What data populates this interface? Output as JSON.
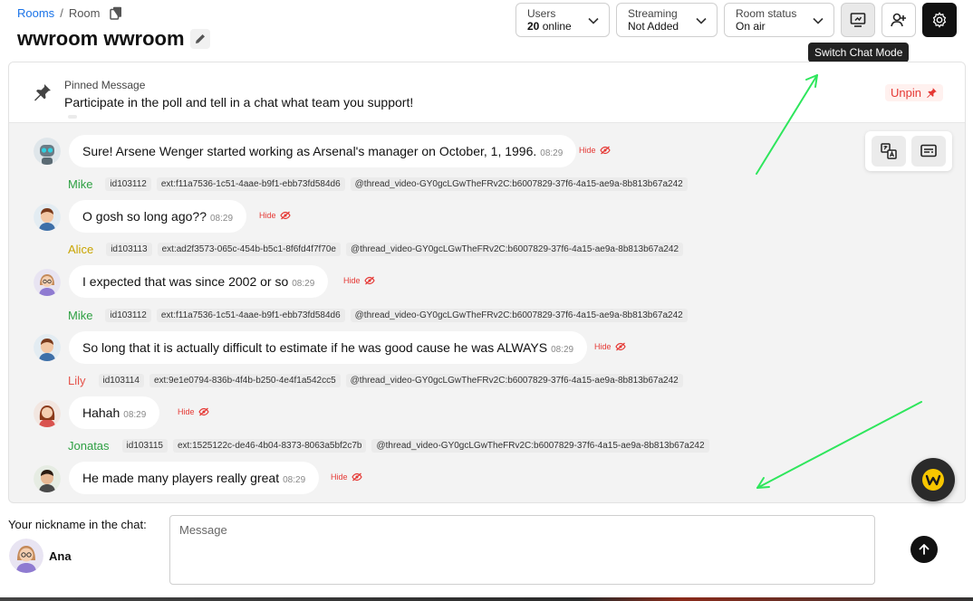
{
  "breadcrumb": {
    "rooms": "Rooms",
    "separator": "/",
    "current": "Room"
  },
  "room": {
    "title": "wwroom wwroom"
  },
  "header": {
    "users": {
      "label": "Users",
      "count": "20",
      "suffix": "online"
    },
    "streaming": {
      "label": "Streaming",
      "value": "Not Added"
    },
    "room_status": {
      "label": "Room status",
      "value": "On air"
    },
    "tooltip": "Switch Chat Mode"
  },
  "pinned": {
    "title": "Pinned Message",
    "text": "Participate in the poll and tell in a chat what team you support!",
    "unpin_label": "Unpin"
  },
  "hide_label": "Hide",
  "messages": [
    {
      "author": "",
      "avatar": "robot",
      "text": "Sure! Arsene Wenger started working as Arsenal's manager on October, 1, 1996.",
      "time": "08:29"
    },
    {
      "author": "Mike",
      "author_color": "#2ea043",
      "user_id": "id103112",
      "ext": "ext:f11a7536-1c51-4aae-b9f1-ebb73fd584d6",
      "thread": "@thread_video-GY0gcLGwTheFRv2C:b6007829-37f6-4a15-ae9a-8b813b67a242",
      "avatar": "mike",
      "text": "O gosh so long ago??",
      "time": "08:29"
    },
    {
      "author": "Alice",
      "author_color": "#c9a400",
      "user_id": "id103113",
      "ext": "ext:ad2f3573-065c-454b-b5c1-8f6fd4f7f70e",
      "thread": "@thread_video-GY0gcLGwTheFRv2C:b6007829-37f6-4a15-ae9a-8b813b67a242",
      "avatar": "alice",
      "text": "I expected that was since 2002 or so",
      "time": "08:29"
    },
    {
      "author": "Mike",
      "author_color": "#2ea043",
      "user_id": "id103112",
      "ext": "ext:f11a7536-1c51-4aae-b9f1-ebb73fd584d6",
      "thread": "@thread_video-GY0gcLGwTheFRv2C:b6007829-37f6-4a15-ae9a-8b813b67a242",
      "avatar": "mike",
      "text": "So long that it is actually difficult to estimate if he was good cause he was ALWAYS",
      "time": "08:29"
    },
    {
      "author": "Lily",
      "author_color": "#e5534b",
      "user_id": "id103114",
      "ext": "ext:9e1e0794-836b-4f4b-b250-4e4f1a542cc5",
      "thread": "@thread_video-GY0gcLGwTheFRv2C:b6007829-37f6-4a15-ae9a-8b813b67a242",
      "avatar": "lily",
      "text": "Hahah",
      "time": "08:29"
    },
    {
      "author": "Jonatas",
      "author_color": "#2ea043",
      "user_id": "id103115",
      "ext": "ext:1525122c-de46-4b04-8373-8063a5bf2c7b",
      "thread": "@thread_video-GY0gcLGwTheFRv2C:b6007829-37f6-4a15-ae9a-8b813b67a242",
      "avatar": "jonatas",
      "text": "He made many players really great",
      "time": "08:29"
    }
  ],
  "composer": {
    "nickname_label": "Your nickname in the chat:",
    "nickname": "Ana",
    "placeholder": "Message"
  },
  "icons": {
    "copy": "copy-icon",
    "edit": "pencil-icon",
    "chevron": "chevron-down-icon",
    "chat_mode": "switch-chat-mode-icon",
    "add_user": "add-user-icon",
    "settings": "gear-icon",
    "pin": "pin-icon",
    "unpin": "unpin-icon",
    "hide": "eye-off-icon",
    "translate": "translate-icon",
    "subtitles": "subtitles-icon",
    "send": "arrow-up-icon",
    "assistant": "assistant-logo-icon"
  },
  "colors": {
    "link": "#1a73e8",
    "danger": "#e53935",
    "annotation_arrow": "#2ee65c",
    "panel_bg": "#f3f3f3"
  }
}
